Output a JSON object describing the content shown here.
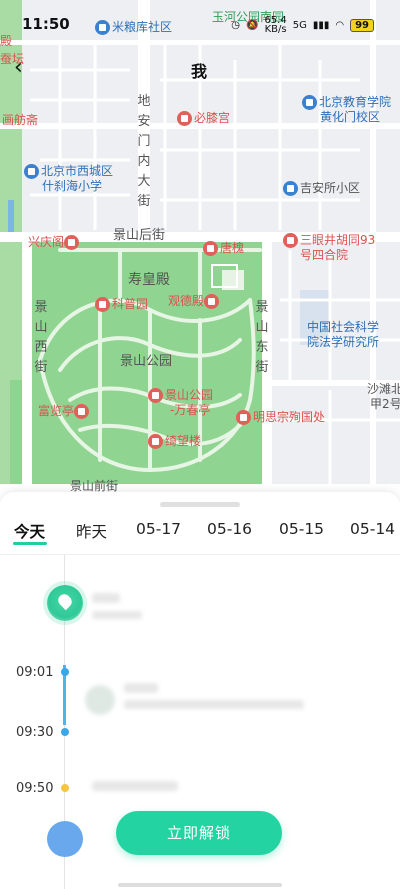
{
  "status_bar": {
    "time": "11:50",
    "network_speed": "65.4",
    "network_unit": "KB/s",
    "signal": "5G",
    "battery": "99"
  },
  "header": {
    "title": "我",
    "back_icon": "back-arrow-icon"
  },
  "map": {
    "pois": [
      {
        "key": "milianku",
        "label": "米粮库社区",
        "color": "blue"
      },
      {
        "key": "yuhe",
        "label": "玉河公园南园",
        "color": "green"
      },
      {
        "key": "huafang",
        "label": "画舫斋",
        "color": "red"
      },
      {
        "key": "bixi",
        "label": "必膝宫",
        "color": "red"
      },
      {
        "key": "edu",
        "label": "北京教育学院",
        "color": "blue"
      },
      {
        "key": "edu2",
        "label": "黄化门校区",
        "color": "blue"
      },
      {
        "key": "xicheng",
        "label": "北京市西城区",
        "color": "blue"
      },
      {
        "key": "xicheng2",
        "label": "什刹海小学",
        "color": "blue"
      },
      {
        "key": "jian",
        "label": "吉安所小区",
        "color": "grey"
      },
      {
        "key": "xingqing",
        "label": "兴庆阁",
        "color": "red"
      },
      {
        "key": "jingshanhou",
        "label": "景山后街",
        "color": "grey"
      },
      {
        "key": "tanghuai",
        "label": "唐槐",
        "color": "red"
      },
      {
        "key": "sanyan",
        "label": "三眼井胡同93",
        "color": "red"
      },
      {
        "key": "sanyan2",
        "label": "号四合院",
        "color": "red"
      },
      {
        "key": "shouhuang",
        "label": "寿皇殿",
        "color": "grey"
      },
      {
        "key": "kepu",
        "label": "科普园",
        "color": "red"
      },
      {
        "key": "guande",
        "label": "观德殿",
        "color": "red"
      },
      {
        "key": "jingshangongyuan",
        "label": "景山公园",
        "color": "grey"
      },
      {
        "key": "cass",
        "label": "中国社会科学",
        "color": "blue"
      },
      {
        "key": "cass2",
        "label": "院法学研究所",
        "color": "blue"
      },
      {
        "key": "fulan",
        "label": "富览亭",
        "color": "red"
      },
      {
        "key": "wanchun",
        "label": "景山公园",
        "color": "red"
      },
      {
        "key": "wanchun2",
        "label": "-万春亭",
        "color": "red"
      },
      {
        "key": "mingsi",
        "label": "明思宗殉国处",
        "color": "red"
      },
      {
        "key": "qiwang",
        "label": "绮望楼",
        "color": "red"
      },
      {
        "key": "shatan",
        "label": "沙滩北",
        "color": "grey"
      },
      {
        "key": "shatan2",
        "label": "甲2号",
        "color": "grey"
      },
      {
        "key": "jingshanqian",
        "label": "景山前街",
        "color": "grey"
      },
      {
        "key": "haidian_left",
        "label": "蚕坛",
        "color": "red"
      },
      {
        "key": "left_edge",
        "label": "殿",
        "color": "red"
      }
    ],
    "vertical_streets": [
      {
        "key": "dianmen",
        "label": "地安门内大街"
      },
      {
        "key": "jingshanxi",
        "label": "景山西街"
      },
      {
        "key": "jingshandong",
        "label": "景山东街"
      }
    ]
  },
  "tabs": [
    {
      "label": "今天",
      "active": true
    },
    {
      "label": "昨天",
      "active": false
    },
    {
      "label": "05-17",
      "active": false
    },
    {
      "label": "05-16",
      "active": false
    },
    {
      "label": "05-15",
      "active": false
    },
    {
      "label": "05-14",
      "active": false
    }
  ],
  "timeline": {
    "times": [
      "09:01",
      "09:30",
      "09:50"
    ]
  },
  "primary_action": {
    "label": "立即解锁"
  },
  "colors": {
    "accent": "#24d3a2",
    "park": "#8fd491",
    "map_bg": "#eeeff3",
    "road": "#ffffff",
    "timeline_blue": "#3aa8e8",
    "timeline_yellow": "#f5c542"
  }
}
